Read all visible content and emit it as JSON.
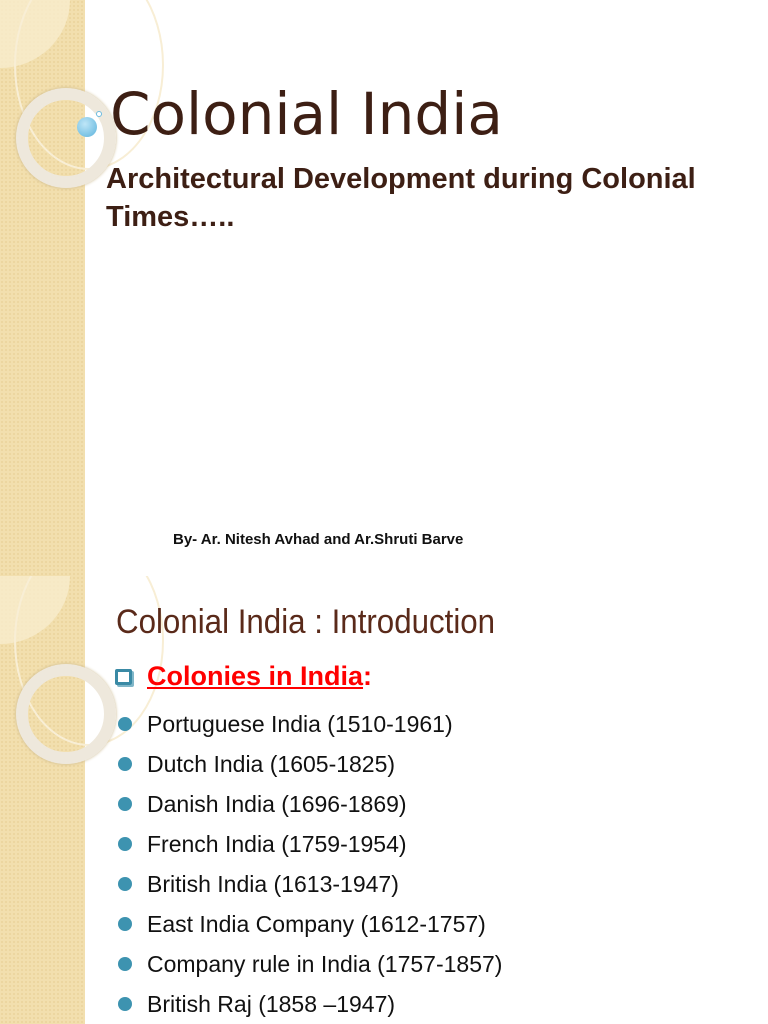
{
  "slide1": {
    "title": "Colonial India",
    "subtitle": "Architectural Development during Colonial Times…..",
    "byline": "By- Ar. Nitesh Avhad and Ar.Shruti Barve"
  },
  "slide2": {
    "title": "Colonial India : Introduction",
    "heading": "Colonies in India",
    "heading_suffix": ":",
    "items": [
      "Portuguese India (1510-1961)",
      "Dutch India (1605-1825)",
      "Danish India (1696-1869)",
      "French India (1759-1954)",
      "British India (1613-1947)",
      "East India Company (1612-1757)",
      "Company rule in India (1757-1857)",
      "British Raj (1858 –1947)"
    ]
  },
  "colors": {
    "title": "#3d1f14",
    "heading": "#ff0000",
    "bullet": "#3d93b0",
    "sidebar": "#f2dfae"
  }
}
